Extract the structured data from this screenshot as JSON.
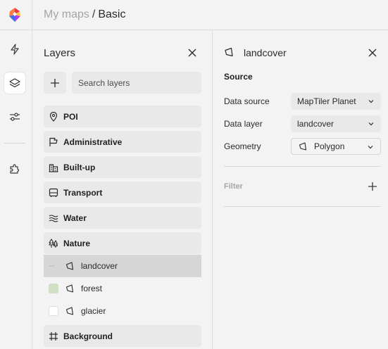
{
  "breadcrumb": {
    "parent": "My maps",
    "separator": "/",
    "current": "Basic"
  },
  "rail": {
    "logo": "maptiler-logo",
    "items": [
      {
        "icon": "lightning-icon",
        "active": false
      },
      {
        "icon": "layers-icon",
        "active": true
      },
      {
        "icon": "sliders-icon",
        "active": false
      },
      {
        "icon": "puzzle-icon",
        "active": false
      }
    ]
  },
  "layers_panel": {
    "title": "Layers",
    "search_placeholder": "Search layers",
    "groups": [
      {
        "icon": "pin-icon",
        "label": "POI"
      },
      {
        "icon": "flag-icon",
        "label": "Administrative"
      },
      {
        "icon": "buildings-icon",
        "label": "Built-up"
      },
      {
        "icon": "bus-icon",
        "label": "Transport"
      },
      {
        "icon": "waves-icon",
        "label": "Water"
      },
      {
        "icon": "trees-icon",
        "label": "Nature"
      },
      {
        "icon": "frame-icon",
        "label": "Background"
      }
    ],
    "nature_layers": [
      {
        "label": "landcover",
        "selected": true,
        "swatch": null
      },
      {
        "label": "forest",
        "selected": false,
        "swatch": "#cfe0c4"
      },
      {
        "label": "glacier",
        "selected": false,
        "swatch": "#ffffff"
      }
    ]
  },
  "properties_panel": {
    "title": "landcover",
    "source_heading": "Source",
    "rows": [
      {
        "label": "Data source",
        "value": "MapTiler Planet"
      },
      {
        "label": "Data layer",
        "value": "landcover"
      },
      {
        "label": "Geometry",
        "value": "Polygon"
      }
    ],
    "filter_heading": "Filter"
  },
  "colors": {
    "logo_red": "#f0384c",
    "logo_yellow": "#ffc83c",
    "logo_blue": "#3e6cf2",
    "logo_purple": "#b43ce8"
  }
}
